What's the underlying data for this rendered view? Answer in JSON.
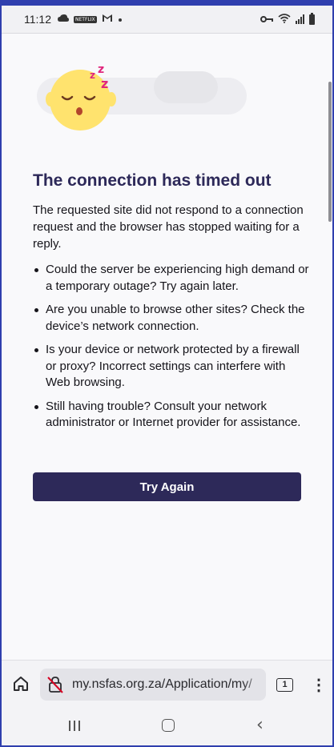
{
  "status_bar": {
    "time": "11:12",
    "icons": [
      "cloud-sync-icon",
      "netflix-icon",
      "gmail-icon",
      "dot-icon",
      "key-icon",
      "wifi-icon",
      "signal-icon",
      "battery-icon"
    ],
    "app_badge": "NETFLIX"
  },
  "error_page": {
    "title": "The connection has timed out",
    "description": "The requested site did not respond to a connection request and the browser has stopped waiting for a reply.",
    "bullets": [
      "Could the server be experiencing high demand or a temporary outage? Try again later.",
      "Are you unable to browse other sites? Check the device’s network connection.",
      "Is your device or network protected by a firewall or proxy? Incorrect settings can interfere with Web browsing.",
      "Still having trouble? Consult your network administrator or Internet provider for assistance."
    ],
    "button_label": "Try Again",
    "accent_color": "#2d2959"
  },
  "toolbar": {
    "url": "my.nsfas.org.za/Application/my/",
    "tab_count": "1",
    "menu_glyph": "⋮"
  },
  "nav": {
    "back_glyph": "‹"
  }
}
